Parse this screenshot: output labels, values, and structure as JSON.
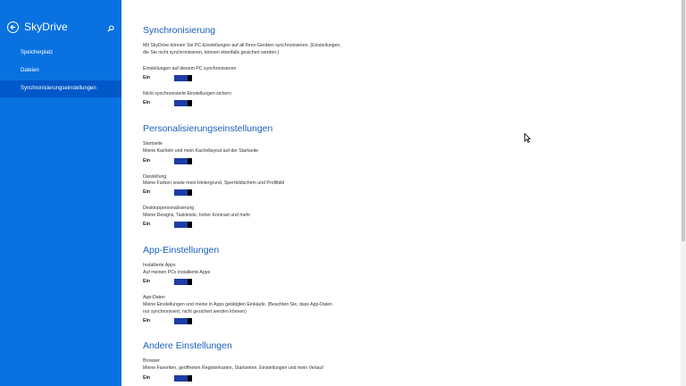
{
  "window": {
    "title": "SkyDrive"
  },
  "nav": {
    "items": [
      {
        "label": "Speicherplatz",
        "active": false
      },
      {
        "label": "Dateien",
        "active": false
      },
      {
        "label": "Synchronisierungseinstellungen",
        "active": true
      }
    ]
  },
  "sections": {
    "sync": {
      "title": "Synchronisierung",
      "description_line1": "Mit SkyDrive können Sie PC-Einstellungen auf all Ihren Geräten synchronisieren. (Einstellungen,",
      "description_line2": "die Sie nicht synchronisieren, können ebenfalls gesichert werden.)",
      "setting1": {
        "label": "Einstellungen auf diesem PC synchronisieren",
        "state": "Ein"
      },
      "setting2": {
        "label": "Nicht synchronisierte Einstellungen sichern",
        "state": "Ein"
      }
    },
    "personal": {
      "title": "Personalisierungseinstellungen",
      "start": {
        "label": "Startseite",
        "desc": "Meine Kacheln und mein Kachellayout auf der Startseite",
        "state": "Ein"
      },
      "display": {
        "label": "Darstellung",
        "desc": "Meine Farben sowie mein Hintergrund, Sperrbildschirm und Profilbild",
        "state": "Ein"
      },
      "desktop": {
        "label": "Desktoppersonalisierung",
        "desc": "Meine Designs, Taskleiste, hoher Kontrast und mehr",
        "state": "Ein"
      }
    },
    "apps": {
      "title": "App-Einstellungen",
      "installed": {
        "label": "Installierte Apps",
        "desc": "Auf meinen PCs installierte Apps",
        "state": "Ein"
      },
      "appdata": {
        "label": "App-Daten",
        "desc_line1": "Meine Einstellungen und meine in Apps getätigten Einkäufe. (Beachten Sie, dass App-Daten",
        "desc_line2": "nur synchronisiert, nicht gesichert werden können)",
        "state": "Ein"
      }
    },
    "other": {
      "title": "Andere Einstellungen",
      "browser": {
        "label": "Browser",
        "desc": "Meine Favoriten, geöffneten Registerkarten, Startseiten, Einstellungen und mein Verlauf",
        "state": "Ein"
      }
    }
  },
  "icons": {
    "back": "back-arrow-icon",
    "search": "search-icon"
  },
  "colors": {
    "sidebar": "#0a72e0",
    "accent": "#1a5fbf",
    "toggle": "#1e3ca8"
  }
}
